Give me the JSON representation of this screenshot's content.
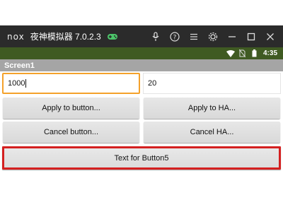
{
  "emulator": {
    "logo": "nox",
    "title": "夜神模拟器 7.0.2.3"
  },
  "status_bar": {
    "time": "4:35"
  },
  "app": {
    "title": "Screen1"
  },
  "fields": {
    "field1_value": "1000",
    "field2_value": "20"
  },
  "buttons": {
    "apply_button": "Apply to button...",
    "apply_ha": "Apply to HA...",
    "cancel_button": "Cancel button...",
    "cancel_ha": "Cancel HA...",
    "button5": "Text for Button5"
  },
  "colors": {
    "status_bar_bg": "#3f5a22",
    "title_bar_bg": "#a5a5a5",
    "focus_border": "#f4a12b",
    "highlight_border": "#d42020"
  }
}
